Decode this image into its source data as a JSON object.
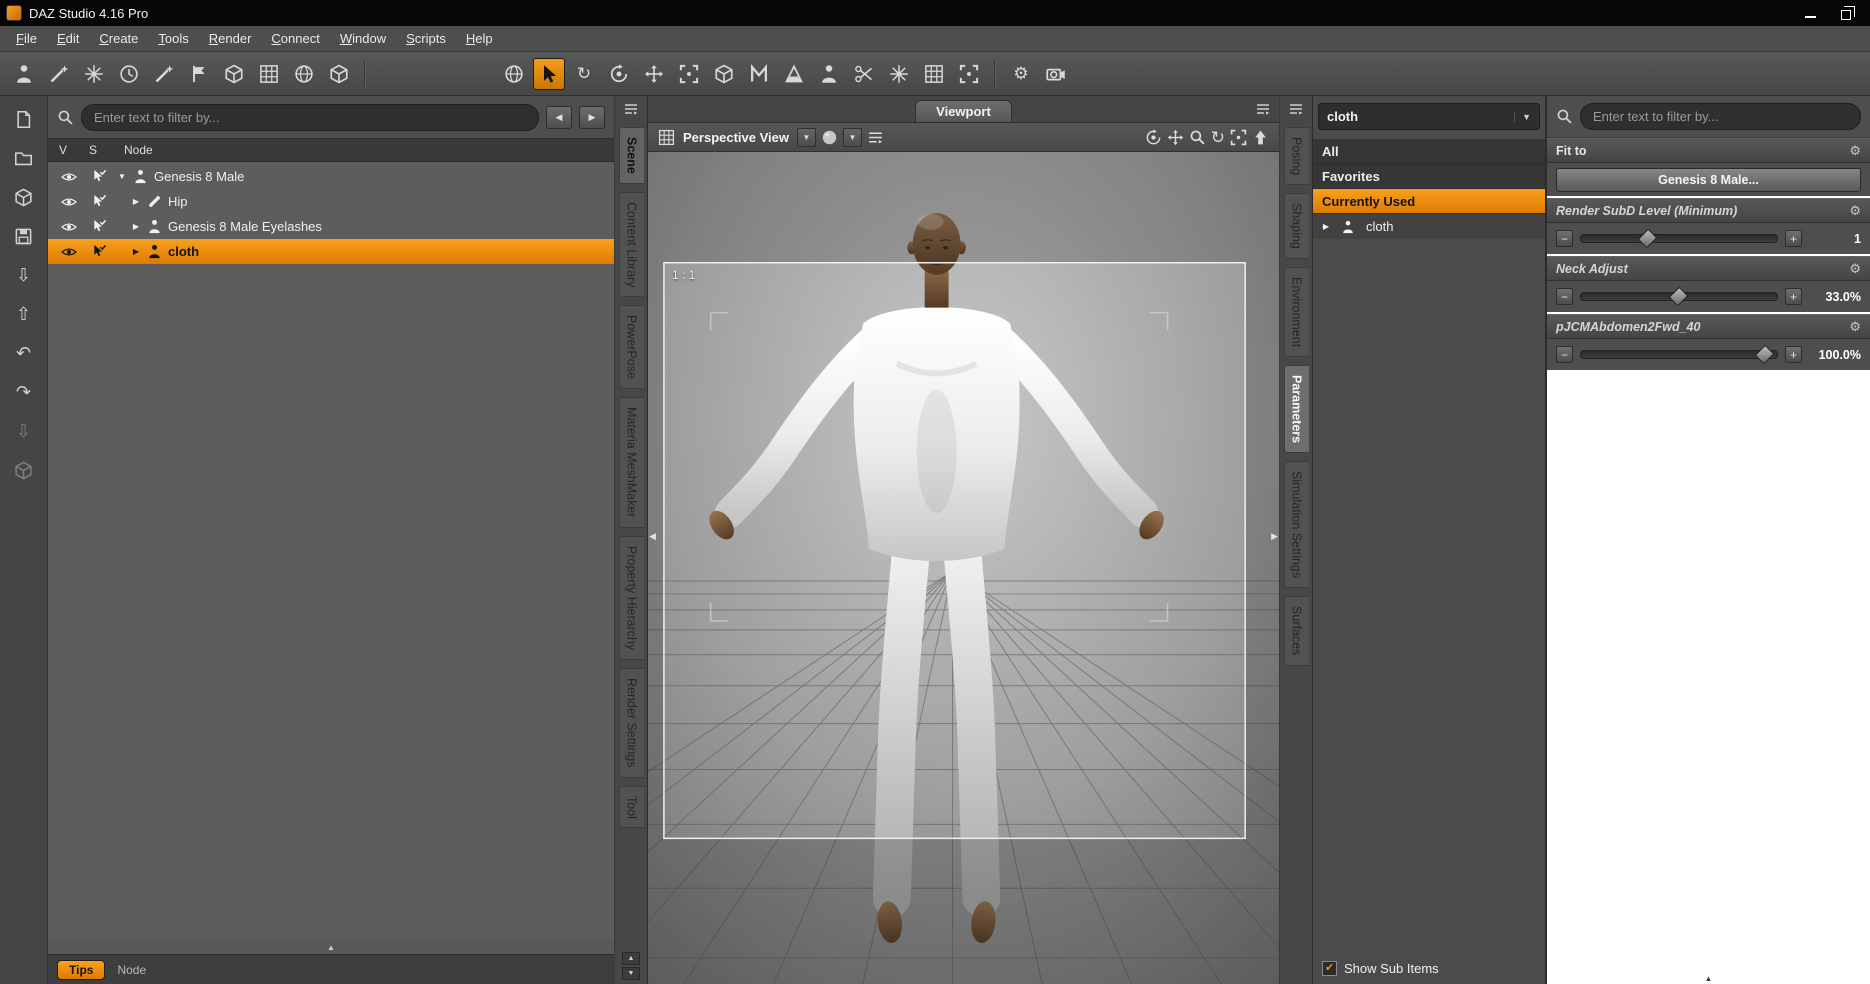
{
  "window": {
    "title": "DAZ Studio 4.16 Pro"
  },
  "menubar": {
    "items": [
      "File",
      "Edit",
      "Create",
      "Tools",
      "Render",
      "Connect",
      "Window",
      "Scripts",
      "Help"
    ]
  },
  "icons": {
    "gear": "⚙",
    "check": "✔",
    "triangle_down": "▼",
    "triangle_right": "▶",
    "triangle_left": "◀",
    "triangle_up": "▲",
    "undo": "↶",
    "redo": "↷",
    "rotate_cw": "↻",
    "arrow_down": "⇩",
    "arrow_up": "⇧",
    "minus": "−",
    "plus": "+"
  },
  "scene_panel": {
    "search_placeholder": "Enter text to filter by...",
    "columns": {
      "v": "V",
      "s": "S",
      "node": "Node"
    },
    "rows": [
      {
        "label": "Genesis 8 Male"
      },
      {
        "label": "Hip"
      },
      {
        "label": "Genesis 8 Male Eyelashes"
      },
      {
        "label": "cloth"
      }
    ],
    "footer": {
      "tips": "Tips",
      "mode": "Node"
    }
  },
  "left_tabs": {
    "items": [
      "Scene",
      "Content Library",
      "PowerPose",
      "Materia MeshMaker",
      "Property Hierarchy",
      "Render Settings",
      "Tool"
    ]
  },
  "viewport": {
    "tab": "Viewport",
    "camera": "Perspective View",
    "aspect_ratio": "1 : 1"
  },
  "right_tabs": {
    "items": [
      "Posing",
      "Shaping",
      "Environment",
      "Parameters",
      "Simulation Settings",
      "Surfaces"
    ]
  },
  "selector_panel": {
    "combo_value": "cloth",
    "filters": [
      "All",
      "Favorites",
      "Currently Used"
    ],
    "tree": [
      {
        "label": "cloth"
      }
    ],
    "show_sub_items": "Show Sub Items"
  },
  "params_panel": {
    "search_placeholder": "Enter text to filter by...",
    "fit_to": {
      "title": "Fit to",
      "button": "Genesis 8 Male..."
    },
    "sliders": [
      {
        "title": "Render SubD Level (Minimum)",
        "value": "1",
        "pct": 34
      },
      {
        "title": "Neck Adjust",
        "value": "33.0%",
        "pct": 50
      },
      {
        "title": "pJCMAbdomen2Fwd_40",
        "value": "100.0%",
        "pct": 94
      }
    ]
  }
}
